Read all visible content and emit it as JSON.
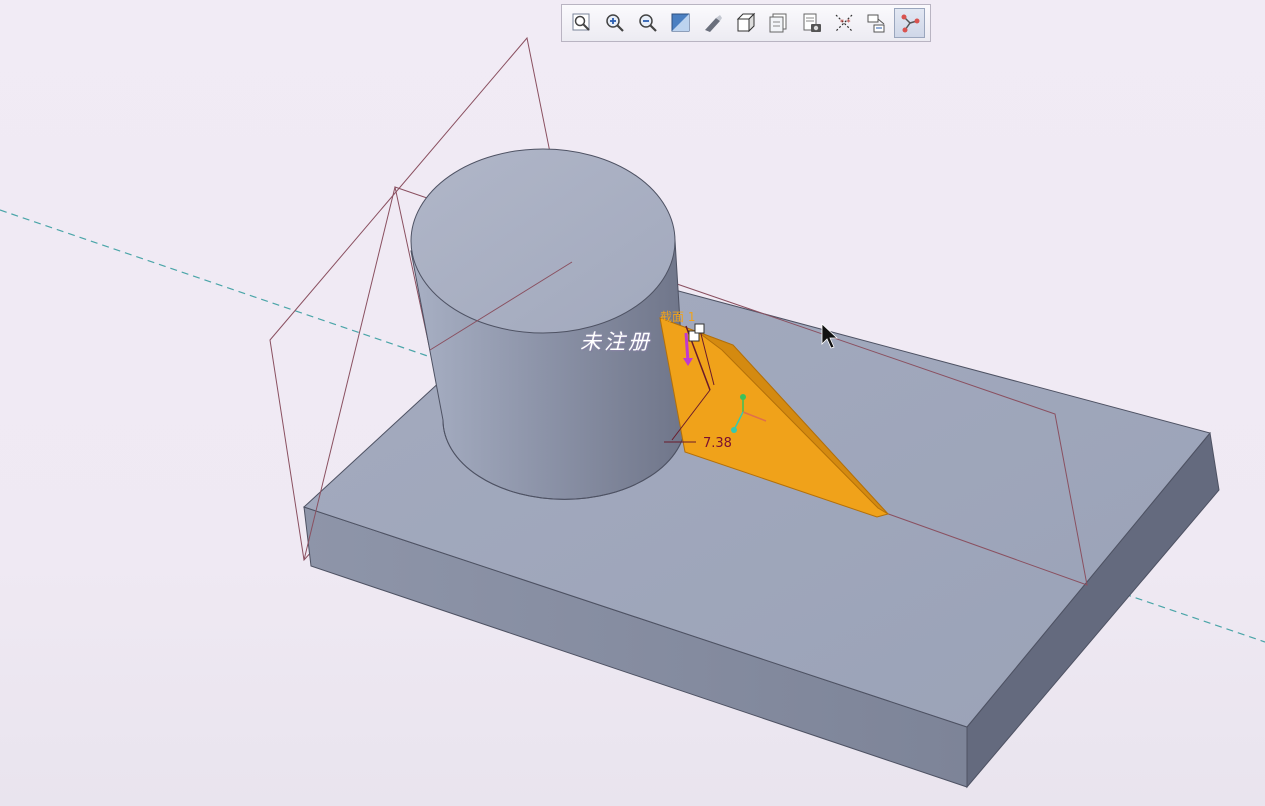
{
  "toolbar": {
    "buttons": [
      {
        "name": "refit-icon"
      },
      {
        "name": "zoom-in-icon"
      },
      {
        "name": "zoom-out-icon"
      },
      {
        "name": "repaint-icon"
      },
      {
        "name": "perspective-icon"
      },
      {
        "name": "display-style-icon"
      },
      {
        "name": "saved-orientations-icon"
      },
      {
        "name": "view-manager-icon"
      },
      {
        "name": "datum-display-icon"
      },
      {
        "name": "annotation-display-icon"
      },
      {
        "name": "spin-center-icon"
      }
    ]
  },
  "viewport": {
    "watermark_text": "未注册",
    "section_label": "截面 1",
    "dimension_value": "7.38"
  },
  "colors": {
    "background": "#f1ebf5",
    "solid_body": "#9aa3b8",
    "rib_fill": "#f0a21a",
    "datum_axis": "#4aa5a8",
    "datum_plane": "#8a5060",
    "dimension": "#7a1030"
  }
}
